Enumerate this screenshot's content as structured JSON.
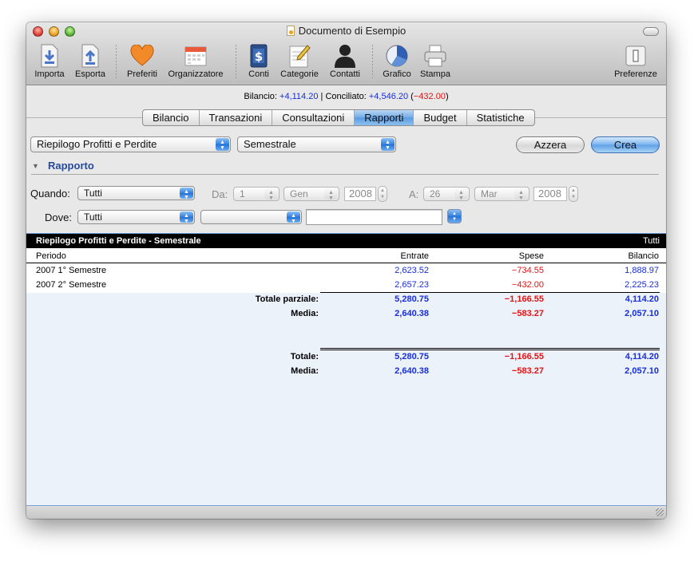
{
  "window": {
    "title": "Documento di Esempio"
  },
  "toolbar": {
    "importa": "Importa",
    "esporta": "Esporta",
    "preferiti": "Preferiti",
    "organizzatore": "Organizzatore",
    "conti": "Conti",
    "categorie": "Categorie",
    "contatti": "Contatti",
    "grafico": "Grafico",
    "stampa": "Stampa",
    "preferenze": "Preferenze"
  },
  "status": {
    "bilancio_label": "Bilancio: ",
    "bilancio_value": "+4,114.20",
    "sep": " | ",
    "conciliato_label": "Conciliato: ",
    "conciliato_value": "+4,546.20",
    "diff_open": " (",
    "diff_value": "−432.00",
    "diff_close": ")"
  },
  "tabs": [
    "Bilancio",
    "Transazioni",
    "Consultazioni",
    "Rapporti",
    "Budget",
    "Statistiche"
  ],
  "controls": {
    "report_type": "Riepilogo Profitti e Perdite",
    "period": "Semestrale",
    "azzera": "Azzera",
    "crea": "Crea",
    "section_title": "Rapporto",
    "quando_label": "Quando:",
    "quando_value": "Tutti",
    "da_label": "Da:",
    "da_day": "1",
    "da_month": "Gen",
    "da_year": "2008",
    "a_label": "A:",
    "a_day": "26",
    "a_month": "Mar",
    "a_year": "2008",
    "dove_label": "Dove:",
    "dove_value": "Tutti",
    "dove_second": ""
  },
  "report": {
    "title": "Riepilogo Profitti e Perdite - Semestrale",
    "scope": "Tutti",
    "columns": {
      "periodo": "Periodo",
      "entrate": "Entrate",
      "spese": "Spese",
      "bilancio": "Bilancio"
    },
    "rows": [
      {
        "periodo": "2007 1° Semestre",
        "entrate": "2,623.52",
        "spese": "−734.55",
        "bilancio": "1,888.97"
      },
      {
        "periodo": "2007 2° Semestre",
        "entrate": "2,657.23",
        "spese": "−432.00",
        "bilancio": "2,225.23"
      }
    ],
    "subtotal": {
      "label": "Totale parziale:",
      "entrate": "5,280.75",
      "spese": "−1,166.55",
      "bilancio": "4,114.20"
    },
    "subtotal_media": {
      "label": "Media:",
      "entrate": "2,640.38",
      "spese": "−583.27",
      "bilancio": "2,057.10"
    },
    "total": {
      "label": "Totale:",
      "entrate": "5,280.75",
      "spese": "−1,166.55",
      "bilancio": "4,114.20"
    },
    "total_media": {
      "label": "Media:",
      "entrate": "2,640.38",
      "spese": "−583.27",
      "bilancio": "2,057.10"
    }
  },
  "colors": {
    "positive": "#1a2ed8",
    "negative": "#e01414",
    "accent": "#5b9ae0"
  }
}
